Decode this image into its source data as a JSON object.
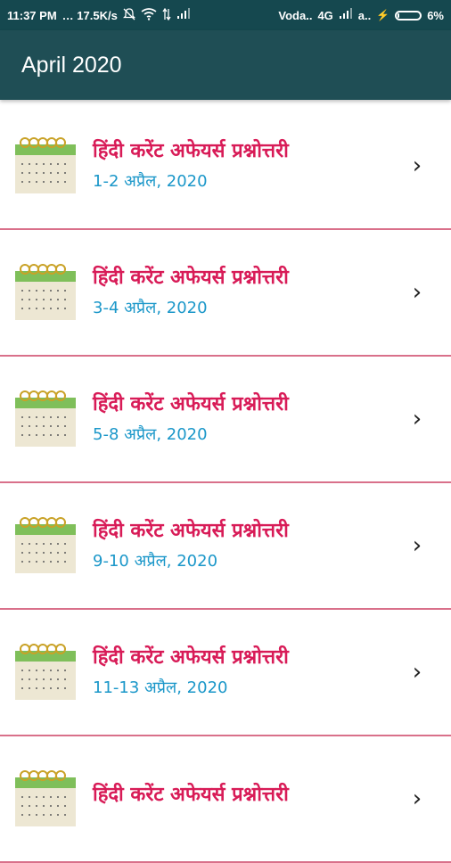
{
  "status_bar": {
    "time": "11:37 PM",
    "speed": "… 17.5K/s",
    "carrier": "Voda..",
    "network": "4G",
    "carrier2": "a..",
    "battery": "6%",
    "battery_level": 0.06
  },
  "app_bar": {
    "title": "April 2020"
  },
  "colors": {
    "status_bar": "#15484f",
    "app_bar": "#1f4e55",
    "title_text": "#d81b57",
    "date_text": "#1b97c9",
    "divider": "#d9708a"
  },
  "items": [
    {
      "title": "हिंदी करेंट अफेयर्स प्रश्नोत्तरी",
      "date": "1-2 अप्रैल, 2020",
      "icon": "calendar-icon",
      "chevron": "›"
    },
    {
      "title": "हिंदी करेंट अफेयर्स प्रश्नोत्तरी",
      "date": "3-4 अप्रैल, 2020",
      "icon": "calendar-icon",
      "chevron": "›"
    },
    {
      "title": "हिंदी करेंट अफेयर्स प्रश्नोत्तरी",
      "date": "5-8 अप्रैल, 2020",
      "icon": "calendar-icon",
      "chevron": "›"
    },
    {
      "title": "हिंदी करेंट अफेयर्स प्रश्नोत्तरी",
      "date": "9-10 अप्रैल, 2020",
      "icon": "calendar-icon",
      "chevron": "›"
    },
    {
      "title": "हिंदी करेंट अफेयर्स प्रश्नोत्तरी",
      "date": "11-13 अप्रैल, 2020",
      "icon": "calendar-icon",
      "chevron": "›"
    },
    {
      "title": "हिंदी करेंट अफेयर्स प्रश्नोत्तरी",
      "date": "",
      "icon": "calendar-icon",
      "chevron": "›"
    }
  ]
}
